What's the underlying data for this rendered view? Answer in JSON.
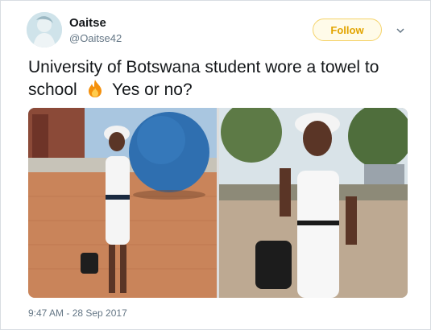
{
  "author": {
    "display_name": "Oaitse",
    "handle": "@Oaitse42"
  },
  "follow_button": {
    "label": "Follow"
  },
  "tweet": {
    "text_before_emoji": "University of Botswana student wore a towel to school",
    "emoji_icon": "fire-emoji-icon",
    "text_after_emoji": "Yes or no?",
    "timestamp": "9:47 AM - 28 Sep 2017"
  },
  "colors": {
    "follow_border": "#f5d36a",
    "follow_text": "#e2a400",
    "text_primary": "#14171a",
    "text_secondary": "#657786"
  }
}
